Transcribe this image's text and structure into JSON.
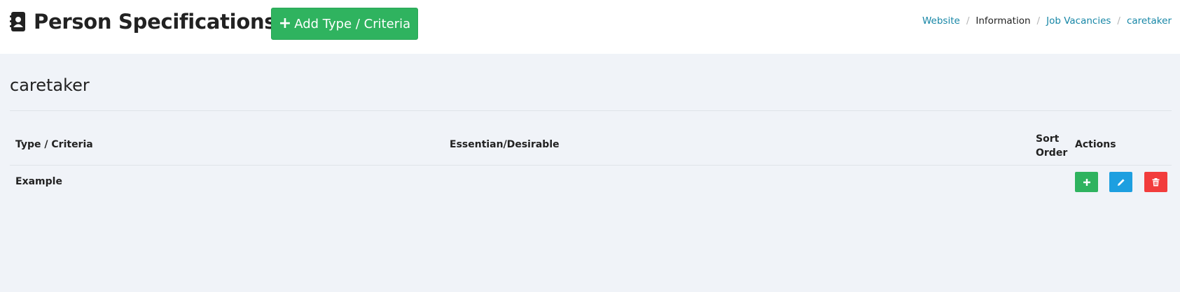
{
  "header": {
    "title": "Person Specifications",
    "title_icon": "address-book-icon",
    "add_button_label": "Add Type / Criteria"
  },
  "breadcrumb": {
    "items": [
      "Website",
      "Information",
      "Job Vacancies",
      "caretaker"
    ],
    "separator": "/"
  },
  "section": {
    "title": "caretaker"
  },
  "table": {
    "columns": [
      "Type / Criteria",
      "Essentian/Desirable",
      "Sort",
      "Order",
      "Actions"
    ],
    "rows": [
      {
        "type": "Example",
        "essential": "",
        "sort_order": ""
      }
    ]
  },
  "actions": {
    "add_icon": "plus-icon",
    "edit_icon": "pencil-icon",
    "delete_icon": "trash-icon"
  },
  "colors": {
    "accent_green": "#2fb35f",
    "edit_blue": "#1d9fe0",
    "delete_red": "#f23c3c",
    "link": "#1686a6",
    "background": "#f0f3f8"
  }
}
